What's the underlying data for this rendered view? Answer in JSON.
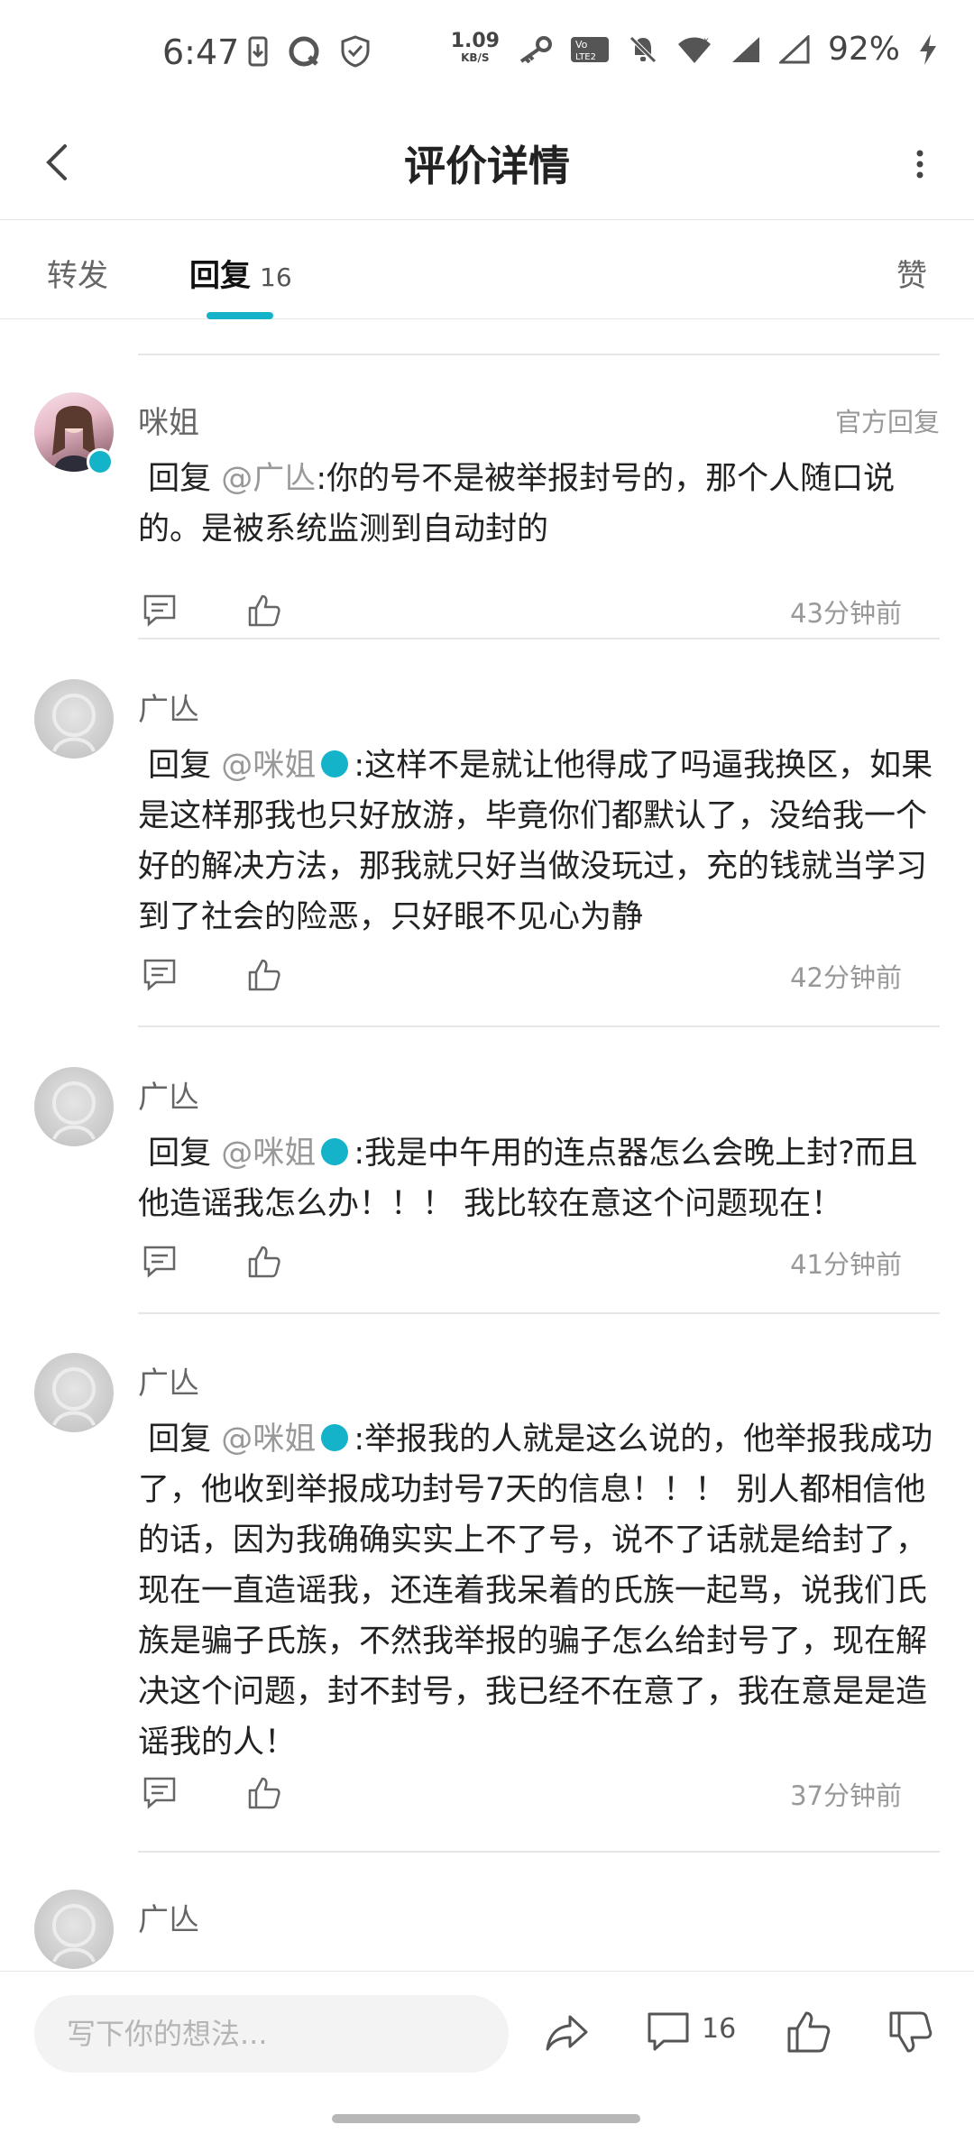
{
  "status_bar": {
    "time": "6:47",
    "net_speed_value": "1.09",
    "net_speed_unit": "KB/S",
    "battery": "92%"
  },
  "header": {
    "title": "评价详情"
  },
  "tabs": {
    "forward": "转发",
    "reply": "回复",
    "reply_count": "16",
    "like": "赞"
  },
  "comments": [
    {
      "user": "咪姐",
      "official_tag": "官方回复",
      "reply_word": "回复",
      "mention": "@广亾",
      "text": ":你的号不是被举报封号的，那个人随口说的。是被系统监测到自动封的",
      "time": "43分钟前"
    },
    {
      "user": "广亾",
      "reply_word": "回复",
      "mention": "@咪姐",
      "text": ":这样不是就让他得成了吗逼我换区，如果是这样那我也只好放游，毕竟你们都默认了，没给我一个好的解决方法，那我就只好当做没玩过，充的钱就当学习到了社会的险恶，只好眼不见心为静",
      "time": "42分钟前"
    },
    {
      "user": "广亾",
      "reply_word": "回复",
      "mention": "@咪姐",
      "text": ":我是中午用的连点器怎么会晚上封?而且他造谣我怎么办！！！ 我比较在意这个问题现在！",
      "time": "41分钟前"
    },
    {
      "user": "广亾",
      "reply_word": "回复",
      "mention": "@咪姐",
      "text": ":举报我的人就是这么说的，他举报我成功了，他收到举报成功封号7天的信息！！！ 别人都相信他的话，因为我确确实实上不了号，说不了话就是给封了，现在一直造谣我，还连着我呆着的氏族一起骂，说我们氏族是骗子氏族，不然我举报的骗子怎么给封号了，现在解决这个问题，封不封号，我已经不在意了，我在意是是造谣我的人！",
      "time": "37分钟前"
    },
    {
      "user": "广亾"
    }
  ],
  "bottom_bar": {
    "input_placeholder": "写下你的想法...",
    "comment_count": "16"
  },
  "colors": {
    "accent": "#15b3c9",
    "muted_text": "#999999"
  }
}
